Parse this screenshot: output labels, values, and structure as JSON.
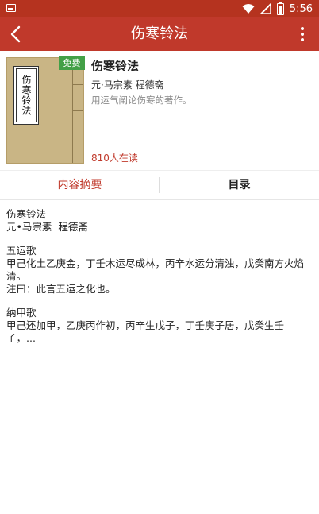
{
  "status_bar": {
    "time": "5:56"
  },
  "app_bar": {
    "title": "伤寒铃法"
  },
  "book": {
    "cover_title": "伤寒铃法",
    "free_badge": "免费",
    "title": "伤寒铃法",
    "author": "元·马宗素 程德斋",
    "description": "用运气阐论伤寒的著作。",
    "readers": "810人在读"
  },
  "tabs": [
    {
      "label": "内容摘要",
      "active": true
    },
    {
      "label": "目录",
      "active": false
    }
  ],
  "summary": {
    "line1": "伤寒铃法",
    "line2": "元•马宗素  程德斋",
    "section1_title": "五运歌",
    "section1_body": "甲己化土乙庚金，丁壬木运尽成林，丙辛水运分清浊，戊癸南方火焰清。",
    "section1_note": "注曰：此言五运之化也。",
    "section2_title": "纳甲歌",
    "section2_body": "甲己还加甲，乙庚丙作初，丙辛生戊子，丁壬庚子居，戊癸生壬子，..."
  },
  "colors": {
    "status_bar": "#b5331f",
    "app_bar": "#c0392b",
    "accent": "#c0392b",
    "free_badge": "#43a047"
  }
}
